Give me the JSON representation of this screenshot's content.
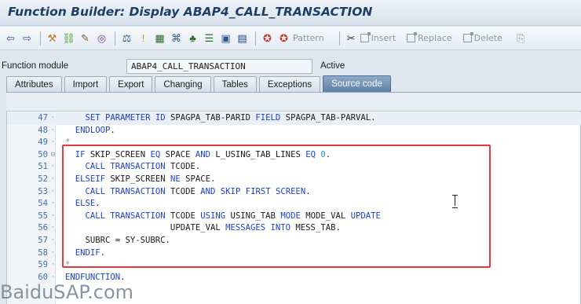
{
  "window": {
    "title": "Function Builder: Display ABAP4_CALL_TRANSACTION"
  },
  "toolbar": {
    "icons": [
      "back-icon",
      "forward-icon",
      "other-object-icon",
      "where-used-icon",
      "display-change-icon",
      "activate-icon",
      "check-icon",
      "test-icon",
      "where-used-list-icon",
      "display-object-list-icon",
      "navigation-window-icon",
      "hierarchy-icon",
      "info-icon",
      "pretty-printer-icon",
      "pattern-icon"
    ],
    "pattern_label": "Pattern",
    "insert_label": "Insert",
    "replace_label": "Replace",
    "delete_label": "Delete"
  },
  "function_module": {
    "label": "Function module",
    "value": "ABAP4_CALL_TRANSACTION",
    "status": "Active"
  },
  "tabs": [
    "Attributes",
    "Import",
    "Export",
    "Changing",
    "Tables",
    "Exceptions",
    "Source code"
  ],
  "active_tab": "Source code",
  "source": {
    "lines": [
      {
        "num": "47",
        "text": "    SET PARAMETER ID SPAGPA_TAB-PARID FIELD SPAGPA_TAB-PARVAL."
      },
      {
        "num": "48",
        "text": "  ENDLOOP."
      },
      {
        "num": "49",
        "text": "*"
      },
      {
        "num": "50",
        "text": "  IF SKIP_SCREEN EQ SPACE AND L_USING_TAB_LINES EQ 0."
      },
      {
        "num": "51",
        "text": "    CALL TRANSACTION TCODE."
      },
      {
        "num": "52",
        "text": "  ELSEIF SKIP_SCREEN NE SPACE."
      },
      {
        "num": "53",
        "text": "    CALL TRANSACTION TCODE AND SKIP FIRST SCREEN."
      },
      {
        "num": "54",
        "text": "  ELSE."
      },
      {
        "num": "55",
        "text": "    CALL TRANSACTION TCODE USING USING_TAB MODE MODE_VAL UPDATE"
      },
      {
        "num": "56",
        "text": "                     UPDATE_VAL MESSAGES INTO MESS_TAB."
      },
      {
        "num": "57",
        "text": "    SUBRC = SY-SUBRC."
      },
      {
        "num": "58",
        "text": "  ENDIF."
      },
      {
        "num": "59",
        "text": "*"
      },
      {
        "num": "60",
        "text": "ENDFUNCTION."
      }
    ]
  },
  "watermark": "BaiduSAP.com",
  "colors": {
    "keyword": "#1c43c9",
    "line_number": "#3f6fb0",
    "highlight_box": "#e03a3a"
  }
}
